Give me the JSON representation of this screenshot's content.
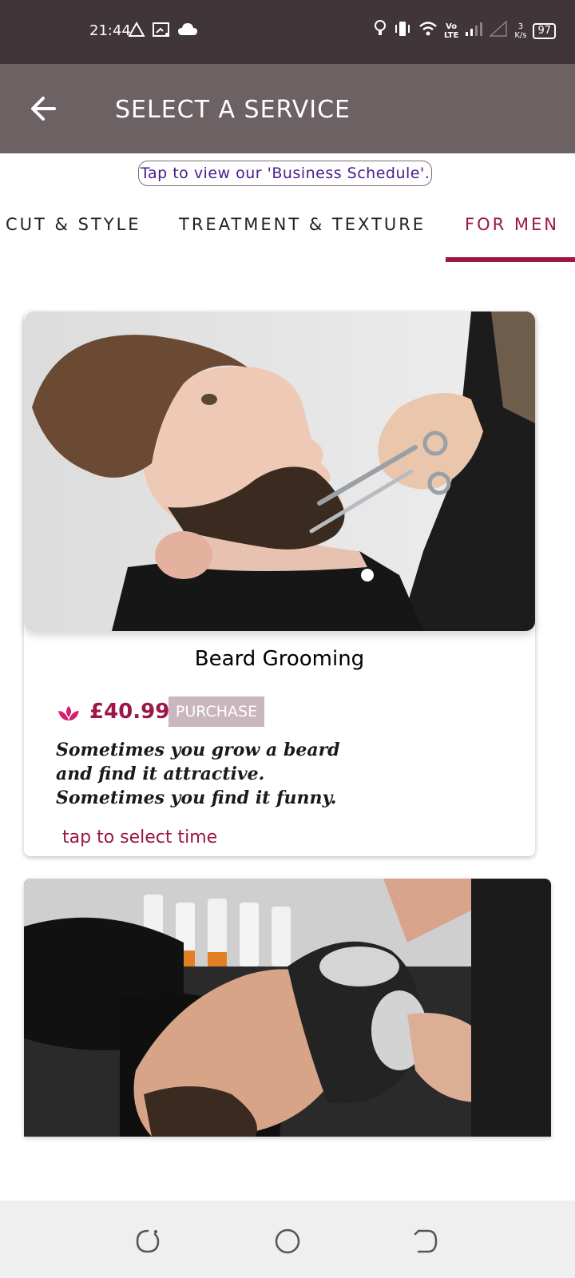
{
  "status_bar": {
    "time": "21:44",
    "battery": "97",
    "net_speed_value": "3",
    "net_speed_unit": "K/s",
    "volte_top": "Vo",
    "volte_bottom": "LTE"
  },
  "app_bar": {
    "title": "SELECT A SERVICE",
    "back_icon": "arrow-left-icon"
  },
  "schedule_link": "Tap to view our 'Business Schedule'.",
  "tabs": [
    {
      "label": "CUT & STYLE",
      "active": false
    },
    {
      "label": "TREATMENT & TEXTURE",
      "active": false
    },
    {
      "label": "FOR MEN",
      "active": true
    }
  ],
  "services": [
    {
      "name": "Beard Grooming",
      "price": "£40.99",
      "purchase_label": "PURCHASE",
      "description": "Sometimes you grow a beard and find it attractive. Sometimes you find it funny.",
      "select_time_label": "tap to select time",
      "image": "man-beard-trim-photo"
    },
    {
      "image": "man-hair-wash-photo"
    }
  ],
  "colors": {
    "accent": "#9b1747",
    "status_bar": "#403539",
    "app_bar": "#6c6264",
    "purchase_bg": "#c9b6bf"
  },
  "nav_bar": {
    "recents_icon": "recents-icon",
    "home_icon": "home-icon",
    "back_icon": "back-icon"
  }
}
